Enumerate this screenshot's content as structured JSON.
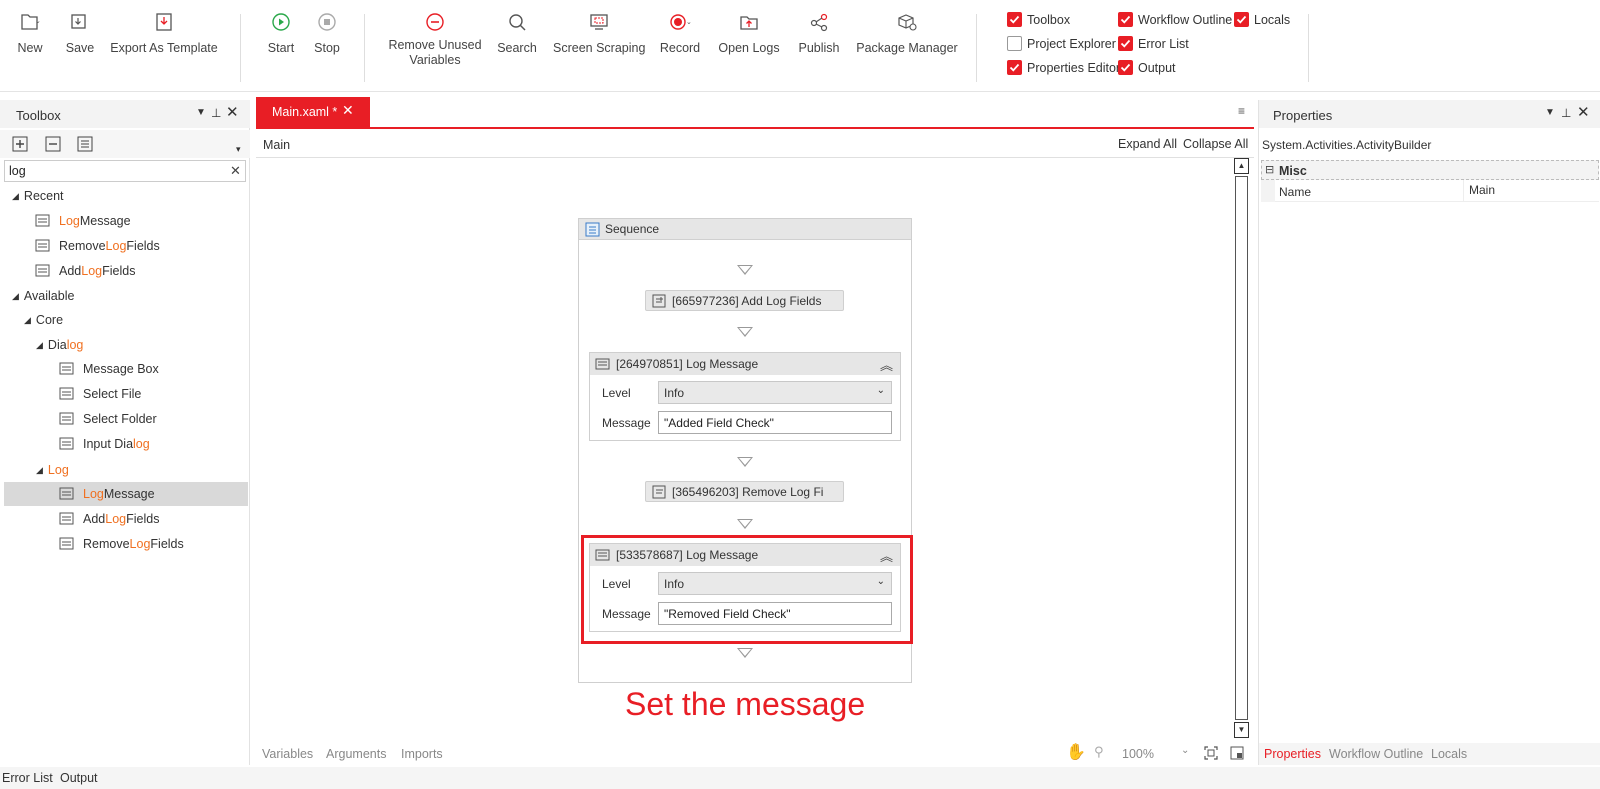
{
  "ribbon": {
    "new": "New",
    "save": "Save",
    "export_template": "Export As Template",
    "start": "Start",
    "stop": "Stop",
    "remove_unused_1": "Remove Unused",
    "remove_unused_2": "Variables",
    "search": "Search",
    "screen_scraping": "Screen Scraping",
    "record": "Record",
    "open_logs": "Open Logs",
    "publish": "Publish",
    "package_manager": "Package Manager"
  },
  "panels_toggles": {
    "toolbox": {
      "label": "Toolbox",
      "checked": true
    },
    "workflow_outline": {
      "label": "Workflow Outline",
      "checked": true
    },
    "locals": {
      "label": "Locals",
      "checked": true
    },
    "project_explorer": {
      "label": "Project Explorer",
      "checked": false
    },
    "error_list": {
      "label": "Error List",
      "checked": true
    },
    "properties_editor": {
      "label": "Properties Editor",
      "checked": true
    },
    "output": {
      "label": "Output",
      "checked": true
    }
  },
  "toolbox": {
    "title": "Toolbox",
    "search_value": "log",
    "recent": "Recent",
    "recent_items": [
      {
        "pre": "",
        "hl": "Log",
        "post": " Message"
      },
      {
        "pre": "Remove ",
        "hl": "Log",
        "post": " Fields"
      },
      {
        "pre": "Add ",
        "hl": "Log",
        "post": " Fields"
      }
    ],
    "available": "Available",
    "core": "Core",
    "dialog_pre": "Dia",
    "dialog_hl": "log",
    "dialog_items": [
      {
        "pre": "Message Box",
        "hl": "",
        "post": ""
      },
      {
        "pre": "Select File",
        "hl": "",
        "post": ""
      },
      {
        "pre": "Select Folder",
        "hl": "",
        "post": ""
      },
      {
        "pre": "Input Dia",
        "hl": "log",
        "post": ""
      }
    ],
    "log_group": "Log",
    "log_items": [
      {
        "pre": "",
        "hl": "Log",
        "post": " Message"
      },
      {
        "pre": "Add ",
        "hl": "Log",
        "post": " Fields"
      },
      {
        "pre": "Remove ",
        "hl": "Log",
        "post": " Fields"
      }
    ]
  },
  "designer": {
    "tab_label": "Main.xaml *",
    "breadcrumb": "Main",
    "expand_all": "Expand All",
    "collapse_all": "Collapse All",
    "sequence_title": "Sequence",
    "activity1": "[665977236] Add Log Fields",
    "activity2": "[264970851] Log Message",
    "activity2_level_label": "Level",
    "activity2_level": "Info",
    "activity2_message_label": "Message",
    "activity2_message": "\"Added Field Check\"",
    "activity3": "[365496203] Remove Log Fi",
    "activity4": "[533578687] Log Message",
    "activity4_level_label": "Level",
    "activity4_level": "Info",
    "activity4_message_label": "Message",
    "activity4_message": "\"Removed Field Check\"",
    "annotation": "Set the message",
    "bottom_tabs": [
      "Variables",
      "Arguments",
      "Imports"
    ],
    "zoom": "100%"
  },
  "properties": {
    "title": "Properties",
    "type": "System.Activities.ActivityBuilder",
    "category": "Misc",
    "name_label": "Name",
    "name_value": "Main",
    "bottom_tabs": [
      "Properties",
      "Workflow Outline",
      "Locals"
    ]
  },
  "status_tabs": [
    "Error List",
    "Output"
  ],
  "colors": {
    "accent": "#e81e25",
    "highlight": "#f07020"
  }
}
